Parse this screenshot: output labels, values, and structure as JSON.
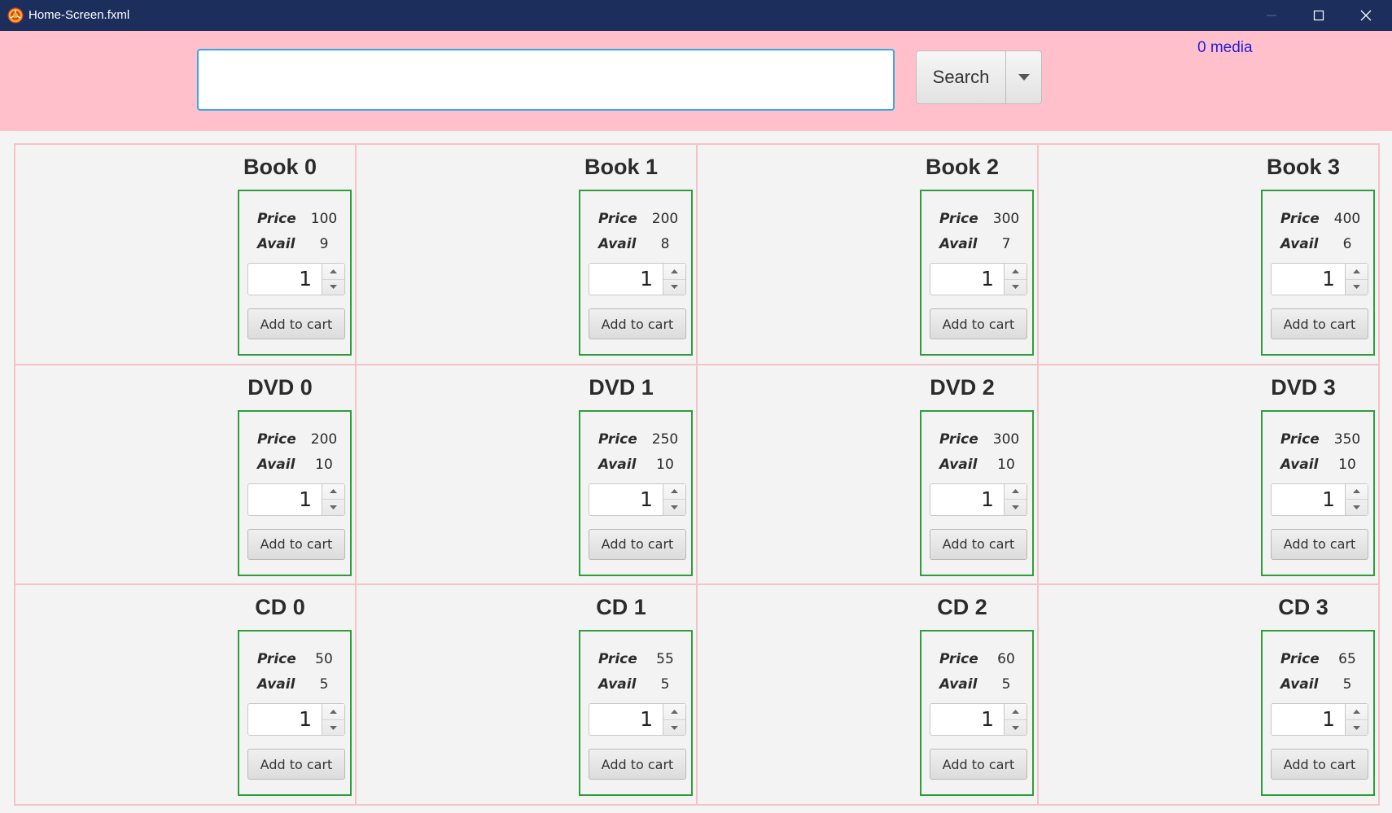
{
  "window": {
    "title": "Home-Screen.fxml",
    "minimize_icon": "minimize-icon",
    "maximize_icon": "maximize-icon",
    "close_icon": "close-icon"
  },
  "topbar": {
    "background": "#ffc0cb",
    "search_value": "",
    "search_label": "Search",
    "media_count": "0 media"
  },
  "labels": {
    "price": "Price",
    "avail": "Avail",
    "add_to_cart": "Add to cart"
  },
  "items": [
    {
      "title": "Book 0",
      "price": "100",
      "avail": "9",
      "qty": "1"
    },
    {
      "title": "Book 1",
      "price": "200",
      "avail": "8",
      "qty": "1"
    },
    {
      "title": "Book 2",
      "price": "300",
      "avail": "7",
      "qty": "1"
    },
    {
      "title": "Book 3",
      "price": "400",
      "avail": "6",
      "qty": "1"
    },
    {
      "title": "DVD 0",
      "price": "200",
      "avail": "10",
      "qty": "1"
    },
    {
      "title": "DVD 1",
      "price": "250",
      "avail": "10",
      "qty": "1"
    },
    {
      "title": "DVD 2",
      "price": "300",
      "avail": "10",
      "qty": "1"
    },
    {
      "title": "DVD 3",
      "price": "350",
      "avail": "10",
      "qty": "1"
    },
    {
      "title": "CD 0",
      "price": "50",
      "avail": "5",
      "qty": "1"
    },
    {
      "title": "CD 1",
      "price": "55",
      "avail": "5",
      "qty": "1"
    },
    {
      "title": "CD 2",
      "price": "60",
      "avail": "5",
      "qty": "1"
    },
    {
      "title": "CD 3",
      "price": "65",
      "avail": "5",
      "qty": "1"
    }
  ]
}
